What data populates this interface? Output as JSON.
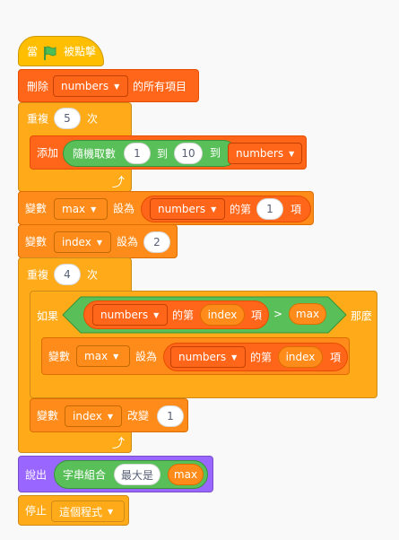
{
  "script": {
    "when_flag": {
      "prefix": "當",
      "suffix": "被點擊"
    },
    "delete_all": {
      "label": "刪除",
      "list": "numbers",
      "suffix": "的所有項目"
    },
    "repeat1": {
      "label": "重複",
      "times": "5",
      "suffix": "次",
      "add": {
        "label": "添加",
        "random_label": "隨機取數",
        "from": "1",
        "to_label": "到",
        "to": "10",
        "to2_label": "到",
        "list": "numbers"
      }
    },
    "set_max": {
      "label": "變數",
      "var": "max",
      "set_label": "設為",
      "list": "numbers",
      "item_label": "的第",
      "index": "1",
      "item_suffix": "項"
    },
    "set_index": {
      "label": "變數",
      "var": "index",
      "set_label": "設為",
      "value": "2"
    },
    "repeat2": {
      "label": "重複",
      "times": "4",
      "suffix": "次",
      "if": {
        "label": "如果",
        "list": "numbers",
        "item_label": "的第",
        "index_var": "index",
        "item_suffix": "項",
        "op": ">",
        "max_var": "max",
        "then": "那麼",
        "set": {
          "label": "變數",
          "var": "max",
          "set_label": "設為",
          "list": "numbers",
          "item_label": "的第",
          "index_var": "index",
          "item_suffix": "項"
        }
      },
      "change": {
        "label": "變數",
        "var": "index",
        "change_label": "改變",
        "by": "1"
      }
    },
    "say": {
      "label": "說出",
      "join_label": "字串組合",
      "text": "最大是",
      "var": "max"
    },
    "stop": {
      "label": "停止",
      "option": "這個程式"
    }
  },
  "colors": {
    "events": "#ffbf00",
    "control": "#ffab19",
    "lists": "#ff661a",
    "variables": "#ff8c1a",
    "operators": "#59c059",
    "looks": "#9966ff",
    "flag": "#4cbf56"
  },
  "icons": {
    "flag": "green-flag-icon",
    "dropdown": "dropdown-arrow-icon",
    "loop": "loop-arrow-icon"
  }
}
